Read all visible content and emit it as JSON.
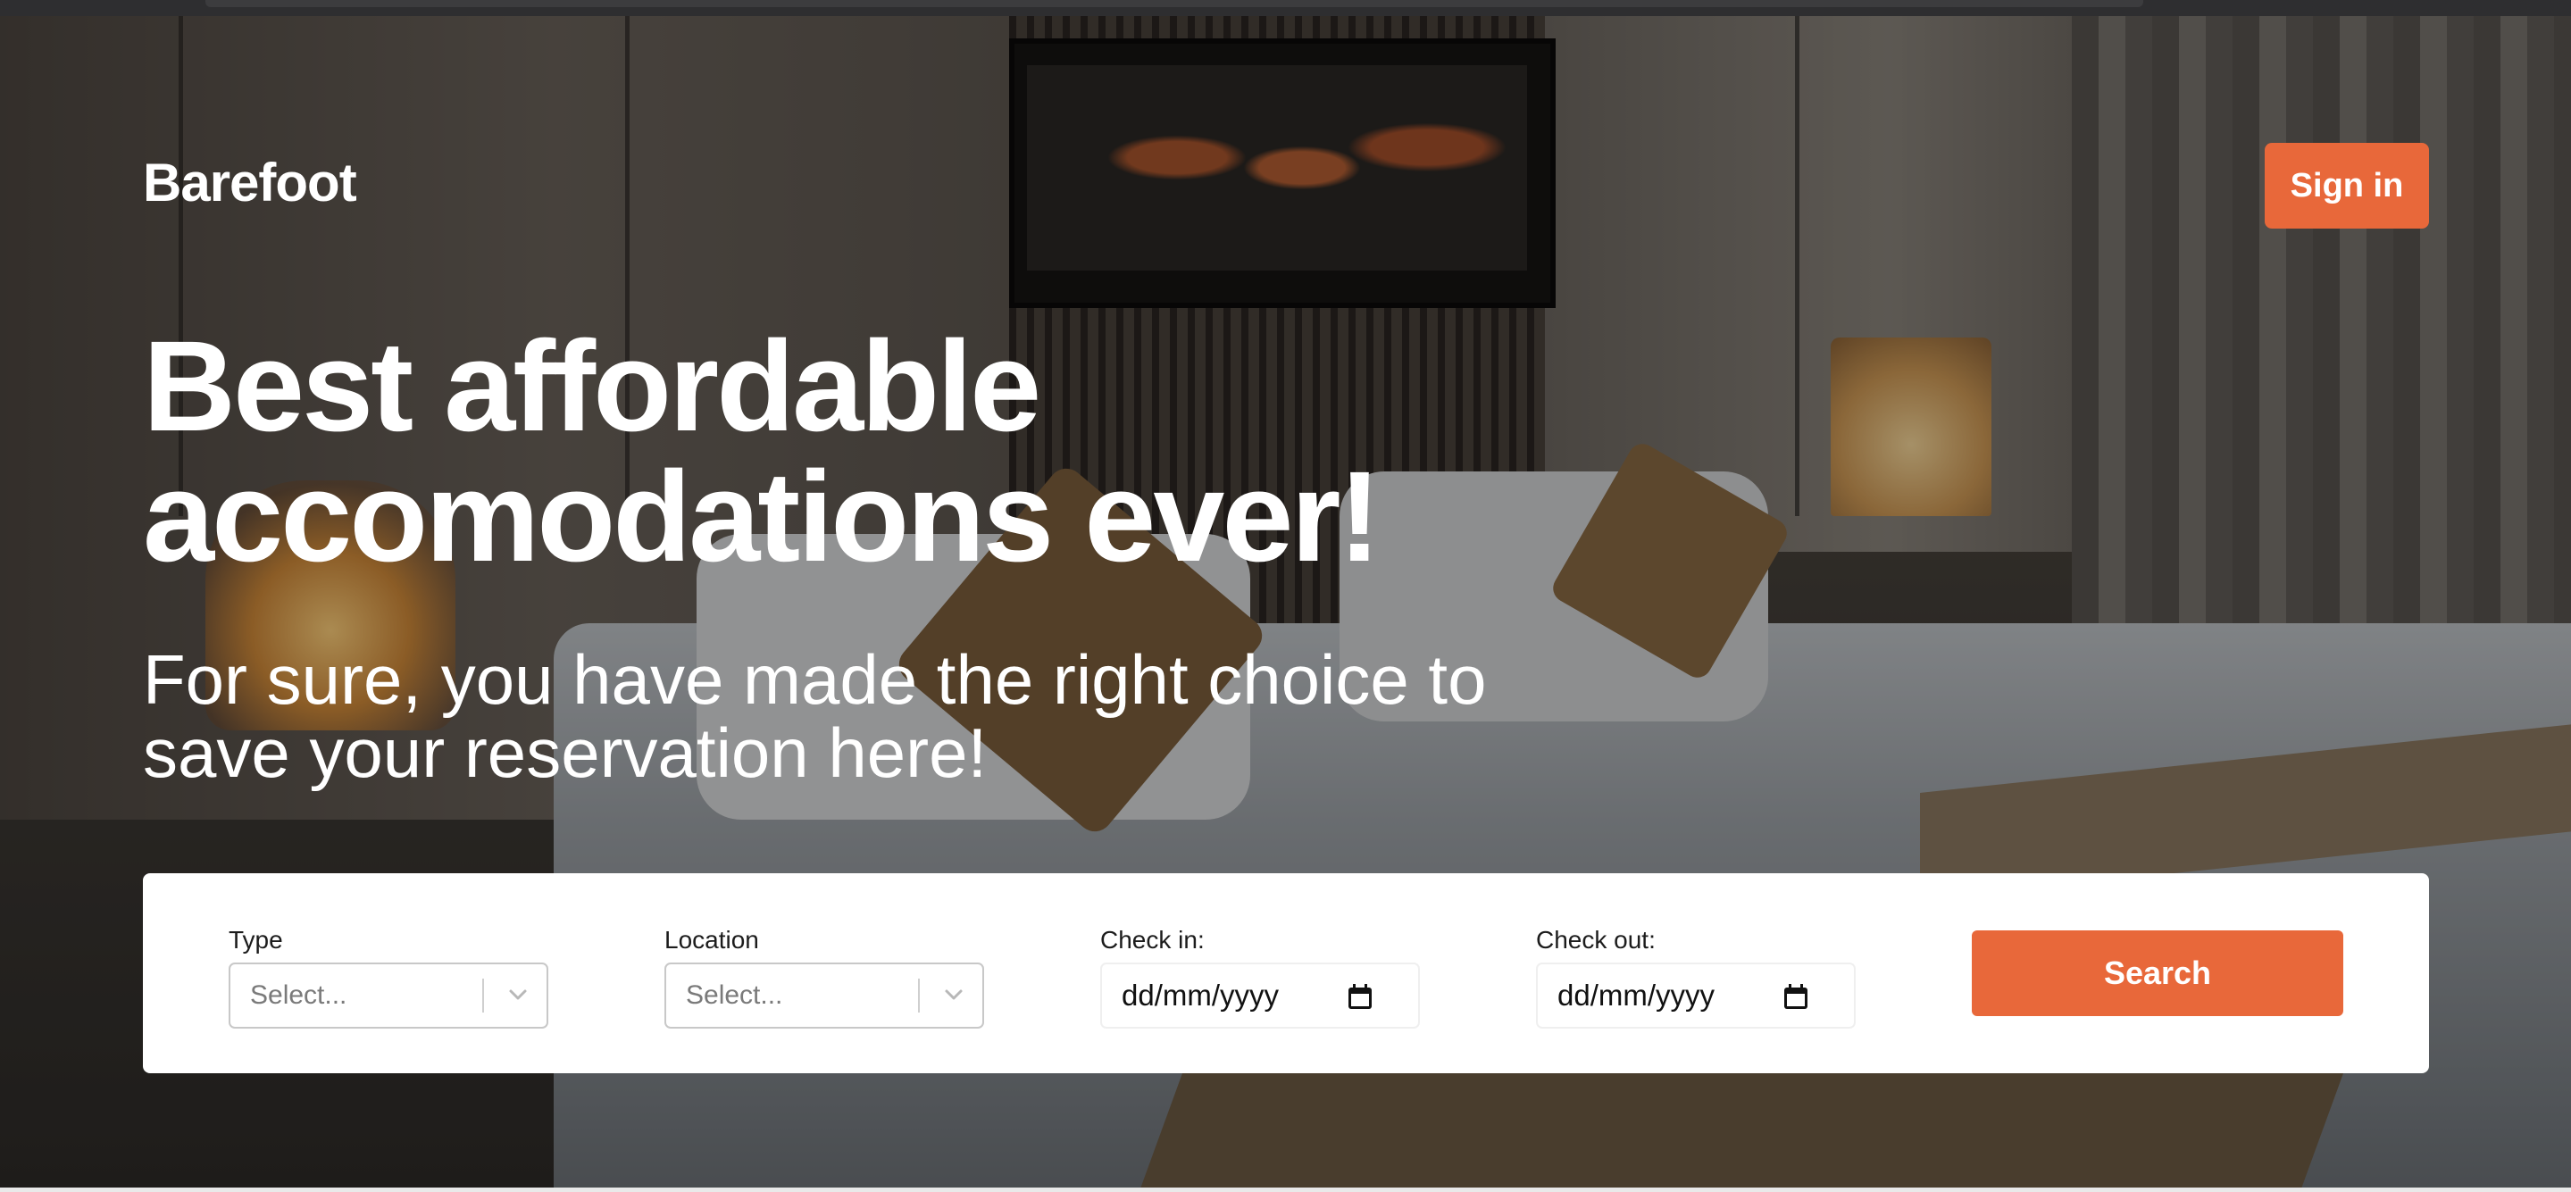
{
  "header": {
    "brand": "Barefoot",
    "signin_label": "Sign in"
  },
  "hero": {
    "headline_line1": "Best affordable",
    "headline_line2": "accomodations ever!",
    "subline_line1": "For sure, you have made the right choice to",
    "subline_line2": "save your reservation here!"
  },
  "search": {
    "type": {
      "label": "Type",
      "placeholder": "Select..."
    },
    "location": {
      "label": "Location",
      "placeholder": "Select..."
    },
    "check_in": {
      "label": "Check in:",
      "placeholder": "dd/mm/yyyy"
    },
    "check_out": {
      "label": "Check out:",
      "placeholder": "dd/mm/yyyy"
    },
    "button_label": "Search"
  },
  "colors": {
    "accent": "#e8683a",
    "text_light": "#ffffff",
    "card_bg": "#ffffff"
  },
  "icons": {
    "dropdown": "chevron-down-icon",
    "date": "calendar-icon"
  }
}
